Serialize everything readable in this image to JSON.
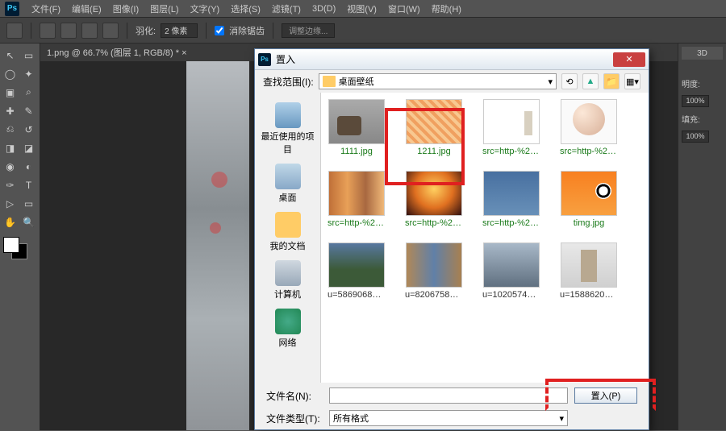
{
  "menubar": {
    "items": [
      "文件(F)",
      "编辑(E)",
      "图像(I)",
      "图层(L)",
      "文字(Y)",
      "选择(S)",
      "滤镜(T)",
      "3D(D)",
      "视图(V)",
      "窗口(W)",
      "帮助(H)"
    ]
  },
  "optbar": {
    "feather_label": "羽化:",
    "feather_value": "2 像素",
    "antialias_label": "消除锯齿",
    "refine_label": "调整边缘..."
  },
  "tab_title": "1.png @ 66.7% (图层 1, RGB/8) * ×",
  "rightpanel": {
    "tab_3d": "3D",
    "opacity_label": "明度:",
    "opacity_value": "100%",
    "fill_label": "填充:",
    "fill_value": "100%"
  },
  "dialog": {
    "title": "置入",
    "lookin_label": "查找范围(I):",
    "location": "桌面壁纸",
    "sidebar": [
      {
        "label": "最近使用的项目"
      },
      {
        "label": "桌面"
      },
      {
        "label": "我的文档"
      },
      {
        "label": "计算机"
      },
      {
        "label": "网络"
      }
    ],
    "files": [
      {
        "name": "1111.jpg"
      },
      {
        "name": "1211.jpg"
      },
      {
        "name": "src=http-%2F%..."
      },
      {
        "name": "src=http-%2F%..."
      },
      {
        "name": "src=http-%2F%..."
      },
      {
        "name": "src=http-%2F%..."
      },
      {
        "name": "src=http-%2F%..."
      },
      {
        "name": "timg.jpg"
      },
      {
        "name": "u=586906862,..."
      },
      {
        "name": "u=820675813,..."
      },
      {
        "name": "u=102057406..."
      },
      {
        "name": "u=158862091..."
      }
    ],
    "filename_label": "文件名(N):",
    "filename_value": "",
    "filetype_label": "文件类型(T):",
    "filetype_value": "所有格式",
    "open_btn": "置入(P)"
  }
}
